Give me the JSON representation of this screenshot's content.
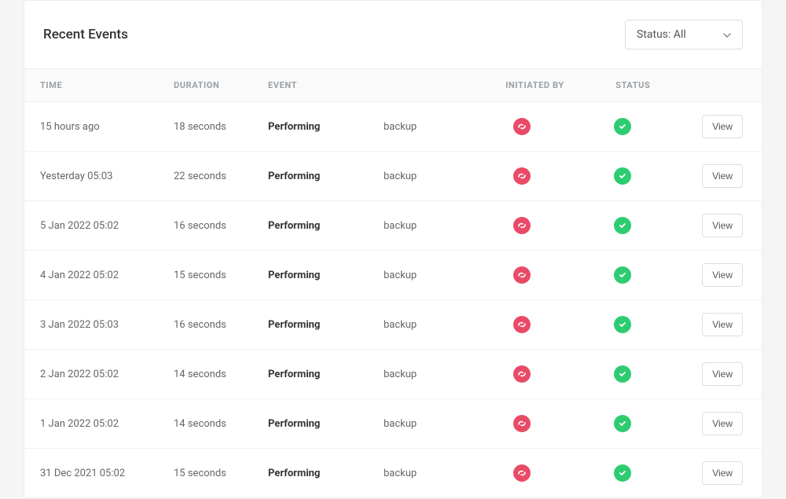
{
  "header": {
    "title": "Recent Events",
    "status_filter_label": "Status: All"
  },
  "columns": {
    "time": "TIME",
    "duration": "DURATION",
    "event": "EVENT",
    "initiated_by": "INITIATED BY",
    "status": "STATUS"
  },
  "icons": {
    "initiator": "swirl-icon",
    "status_ok": "check-icon"
  },
  "colors": {
    "initiator_bg": "#e94b66",
    "status_ok_bg": "#2ecc71"
  },
  "buttons": {
    "view": "View"
  },
  "rows": [
    {
      "time": "15 hours ago",
      "duration": "18 seconds",
      "event_prefix": "Performing",
      "event_suffix": "backup"
    },
    {
      "time": "Yesterday 05:03",
      "duration": "22 seconds",
      "event_prefix": "Performing",
      "event_suffix": "backup"
    },
    {
      "time": "5 Jan 2022 05:02",
      "duration": "16 seconds",
      "event_prefix": "Performing",
      "event_suffix": "backup"
    },
    {
      "time": "4 Jan 2022 05:02",
      "duration": "15 seconds",
      "event_prefix": "Performing",
      "event_suffix": "backup"
    },
    {
      "time": "3 Jan 2022 05:03",
      "duration": "16 seconds",
      "event_prefix": "Performing",
      "event_suffix": "backup"
    },
    {
      "time": "2 Jan 2022 05:02",
      "duration": "14 seconds",
      "event_prefix": "Performing",
      "event_suffix": "backup"
    },
    {
      "time": "1 Jan 2022 05:02",
      "duration": "14 seconds",
      "event_prefix": "Performing",
      "event_suffix": "backup"
    },
    {
      "time": "31 Dec 2021 05:02",
      "duration": "15 seconds",
      "event_prefix": "Performing",
      "event_suffix": "backup"
    }
  ]
}
